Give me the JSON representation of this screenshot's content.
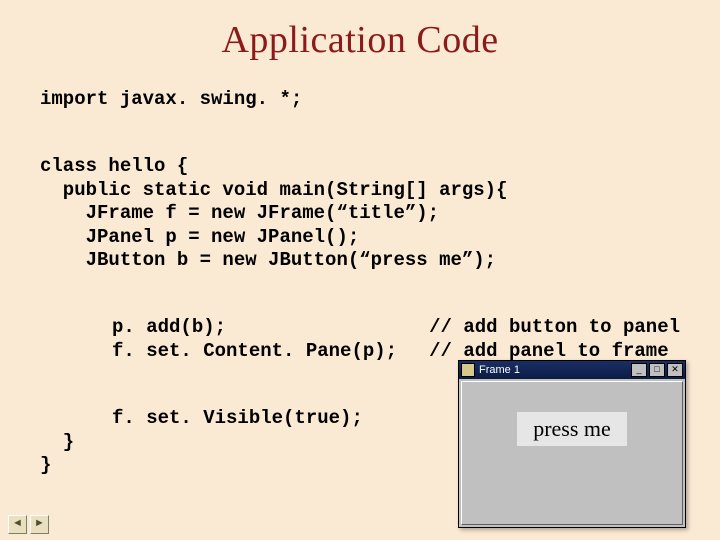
{
  "title": "Application Code",
  "code": {
    "import_line": "import javax. swing. *;",
    "class_open": "class hello {",
    "main_sig": "  public static void main(String[] args){",
    "l_frame": "    JFrame f = new JFrame(“title”);",
    "l_panel": "    JPanel p = new JPanel();",
    "l_button": "    JButton b = new JButton(“press me”);",
    "l_add_b": "p. add(b);",
    "l_setcp": "f. set. Content. Pane(p);",
    "c_add_b": "// add button to panel",
    "c_setcp": "// add panel to frame",
    "l_setvis": "f. set. Visible(true);",
    "close_method": "  }",
    "close_class": "}"
  },
  "window": {
    "title": "Frame 1",
    "min": "_",
    "max": "□",
    "close": "✕",
    "button_label": "press me"
  },
  "nav": {
    "prev": "◄",
    "next": "►"
  }
}
